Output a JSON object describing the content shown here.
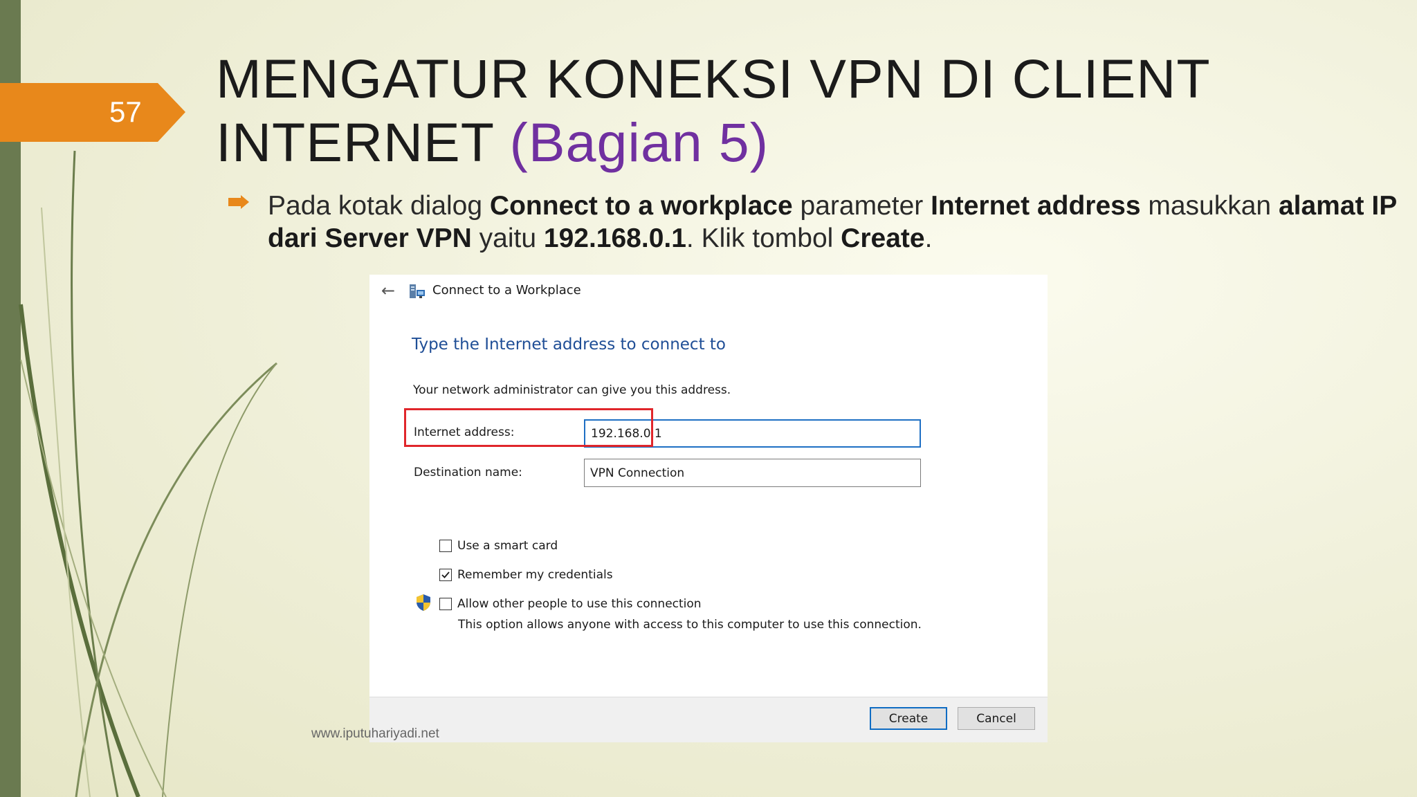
{
  "slide": {
    "number": "57",
    "title_line1": "MENGATUR KONEKSI VPN DI CLIENT",
    "title_line2_main": "INTERNET",
    "title_line2_accent": "(Bagian 5)",
    "bullet": {
      "t1": "Pada kotak dialog ",
      "b1": "Connect to a workplace",
      "t2": " parameter ",
      "b2": "Internet address",
      "t3": " masukkan ",
      "b3": "alamat IP dari Server VPN",
      "t4": " yaitu ",
      "b4": "192.168.0.1",
      "t5": ". Klik tombol ",
      "b5": "Create",
      "t6": "."
    },
    "watermark": "www.iputuhariyadi.net",
    "accent_color": "#7030a0",
    "tab_color": "#e8881b"
  },
  "dialog": {
    "window_title": "Connect to a Workplace",
    "heading": "Type the Internet address to connect to",
    "instruction": "Your network administrator can give you this address.",
    "internet_address_label": "Internet address:",
    "internet_address_value": "192.168.0.1",
    "destination_name_label": "Destination name:",
    "destination_name_value": "VPN Connection",
    "options": [
      {
        "label": "Use a smart card",
        "checked": false
      },
      {
        "label": "Remember my credentials",
        "checked": true
      },
      {
        "label": "Allow other people to use this connection",
        "checked": false
      }
    ],
    "allow_note": "This option allows anyone with access to this computer to use this connection.",
    "create_label": "Create",
    "cancel_label": "Cancel",
    "icons": {
      "back": "back-arrow-icon",
      "app": "network-workplace-icon",
      "uac": "uac-shield-icon",
      "check": "checkmark-icon"
    }
  }
}
